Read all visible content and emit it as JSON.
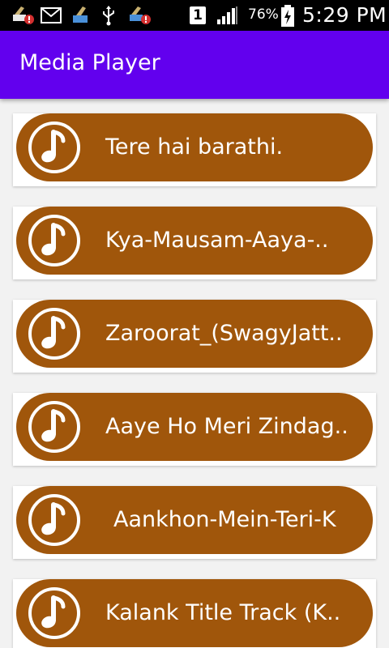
{
  "status_bar": {
    "battery_percent": "76%",
    "time": "5:29 PM",
    "sim_slot": "1",
    "icons": [
      "cleaner-alert-icon",
      "mail-icon",
      "cleaner-icon",
      "usb-icon",
      "cleaner-alert-icon",
      "sim-1-icon",
      "signal-icon",
      "battery-charging-icon"
    ]
  },
  "app_bar": {
    "title": "Media Player",
    "color": "#6200ee"
  },
  "songs": [
    {
      "title": "Tere hai barathi."
    },
    {
      "title": "Kya-Mausam-Aaya-.."
    },
    {
      "title": "Zaroorat_(SwagyJatt.."
    },
    {
      "title": "Aaye Ho Meri Zindag.."
    },
    {
      "title": "Aankhon-Mein-Teri-K"
    },
    {
      "title": "Kalank Title Track (K.."
    }
  ],
  "colors": {
    "pill": "#a0560b",
    "card": "#ffffff",
    "background": "#f2f2f2"
  },
  "icons": {
    "song_icon": "music-note-icon"
  }
}
